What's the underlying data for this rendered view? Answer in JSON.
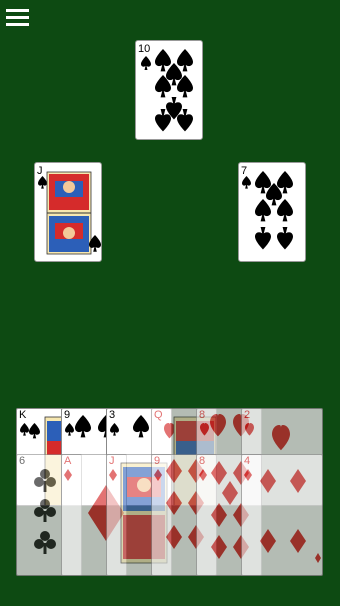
{
  "menu": {
    "icon": "hamburger-menu-icon"
  },
  "table": {
    "background": "#0d4a12",
    "played": [
      {
        "position": "top",
        "rank": "10",
        "suit": "spades",
        "color": "black"
      },
      {
        "position": "left",
        "rank": "J",
        "suit": "spades",
        "color": "black"
      },
      {
        "position": "right",
        "rank": "7",
        "suit": "spades",
        "color": "black"
      }
    ]
  },
  "hand": {
    "row1": [
      {
        "rank": "K",
        "suit": "spades",
        "playable": true
      },
      {
        "rank": "9",
        "suit": "spades",
        "playable": true
      },
      {
        "rank": "3",
        "suit": "spades",
        "playable": true
      },
      {
        "rank": "Q",
        "suit": "hearts",
        "playable": false
      },
      {
        "rank": "8",
        "suit": "hearts",
        "playable": false
      },
      {
        "rank": "2",
        "suit": "hearts",
        "playable": false
      }
    ],
    "row2": [
      {
        "rank": "6",
        "suit": "clubs",
        "playable": false
      },
      {
        "rank": "A",
        "suit": "diamonds",
        "playable": false
      },
      {
        "rank": "J",
        "suit": "diamonds",
        "playable": false
      },
      {
        "rank": "9",
        "suit": "diamonds",
        "playable": false
      },
      {
        "rank": "8",
        "suit": "diamonds",
        "playable": false
      },
      {
        "rank": "4",
        "suit": "diamonds",
        "playable": false
      }
    ]
  }
}
